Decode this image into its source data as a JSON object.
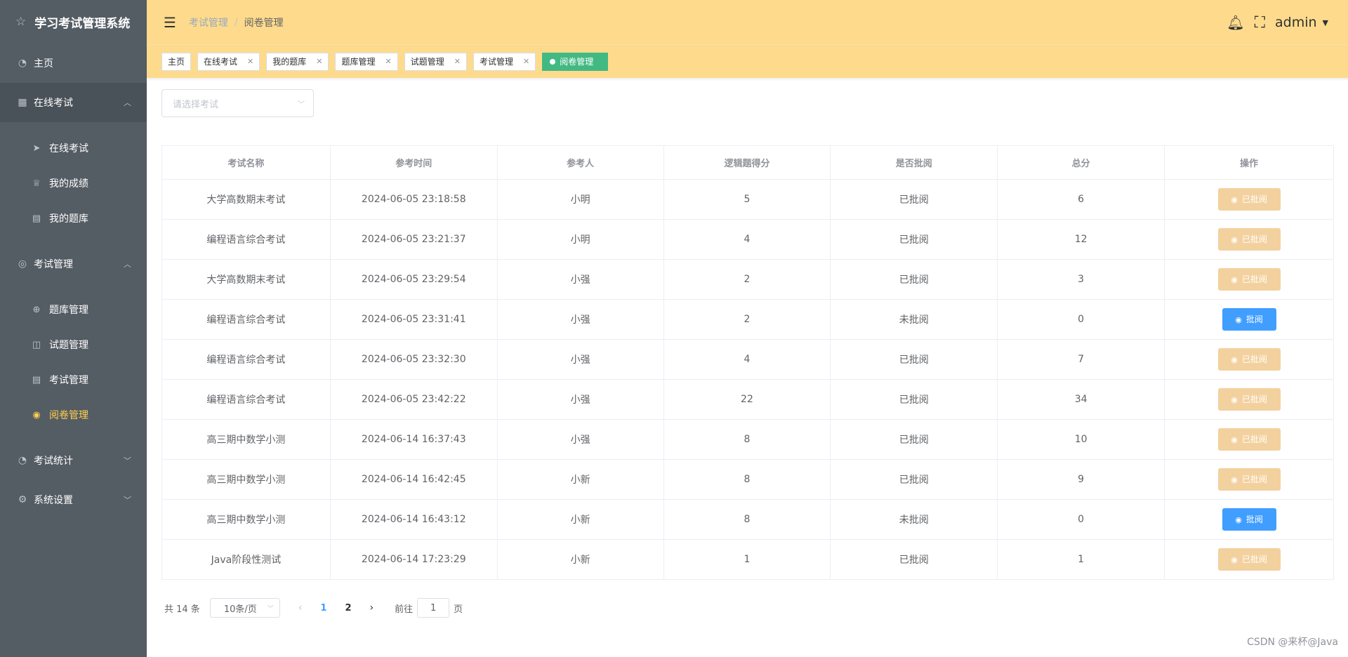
{
  "app": {
    "title": "学习考试管理系统"
  },
  "sidebar": {
    "home": "主页",
    "online_exam": {
      "label": "在线考试",
      "items": [
        "在线考试",
        "我的成绩",
        "我的题库"
      ]
    },
    "exam_mgmt": {
      "label": "考试管理",
      "items": [
        "题库管理",
        "试题管理",
        "考试管理",
        "阅卷管理"
      ]
    },
    "exam_stats": "考试统计",
    "settings": "系统设置"
  },
  "header": {
    "breadcrumb": [
      "考试管理",
      "阅卷管理"
    ],
    "user": "admin"
  },
  "tags": [
    "主页",
    "在线考试",
    "我的题库",
    "题库管理",
    "试题管理",
    "考试管理",
    "阅卷管理"
  ],
  "filter": {
    "placeholder": "请选择考试"
  },
  "table": {
    "headers": [
      "考试名称",
      "参考时间",
      "参考人",
      "逻辑题得分",
      "是否批阅",
      "总分",
      "操作"
    ],
    "rows": [
      {
        "name": "大学高数期末考试",
        "time": "2024-06-05 23:18:58",
        "person": "小明",
        "logic": "5",
        "status": "已批阅",
        "total": "6",
        "action": "已批阅"
      },
      {
        "name": "编程语言综合考试",
        "time": "2024-06-05 23:21:37",
        "person": "小明",
        "logic": "4",
        "status": "已批阅",
        "total": "12",
        "action": "已批阅"
      },
      {
        "name": "大学高数期末考试",
        "time": "2024-06-05 23:29:54",
        "person": "小强",
        "logic": "2",
        "status": "已批阅",
        "total": "3",
        "action": "已批阅"
      },
      {
        "name": "编程语言综合考试",
        "time": "2024-06-05 23:31:41",
        "person": "小强",
        "logic": "2",
        "status": "未批阅",
        "total": "0",
        "action": "批阅"
      },
      {
        "name": "编程语言综合考试",
        "time": "2024-06-05 23:32:30",
        "person": "小强",
        "logic": "4",
        "status": "已批阅",
        "total": "7",
        "action": "已批阅"
      },
      {
        "name": "编程语言综合考试",
        "time": "2024-06-05 23:42:22",
        "person": "小强",
        "logic": "22",
        "status": "已批阅",
        "total": "34",
        "action": "已批阅"
      },
      {
        "name": "高三期中数学小测",
        "time": "2024-06-14 16:37:43",
        "person": "小强",
        "logic": "8",
        "status": "已批阅",
        "total": "10",
        "action": "已批阅"
      },
      {
        "name": "高三期中数学小测",
        "time": "2024-06-14 16:42:45",
        "person": "小新",
        "logic": "8",
        "status": "已批阅",
        "total": "9",
        "action": "已批阅"
      },
      {
        "name": "高三期中数学小测",
        "time": "2024-06-14 16:43:12",
        "person": "小新",
        "logic": "8",
        "status": "未批阅",
        "total": "0",
        "action": "批阅"
      },
      {
        "name": "Java阶段性测试",
        "time": "2024-06-14 17:23:29",
        "person": "小新",
        "logic": "1",
        "status": "已批阅",
        "total": "1",
        "action": "已批阅"
      }
    ]
  },
  "pagination": {
    "total": "共 14 条",
    "page_size": "10条/页",
    "pages": [
      "1",
      "2"
    ],
    "goto_label": "前往",
    "goto_value": "1",
    "goto_suffix": "页"
  },
  "watermark": "CSDN @来杯@Java",
  "colors": {
    "header_bg": "#fedb8c",
    "sidebar_bg": "#545c64",
    "active_menu": "#ffd04b",
    "current_tag": "#42b983",
    "reviewed_btn": "#f3d19e",
    "review_btn": "#409eff"
  }
}
